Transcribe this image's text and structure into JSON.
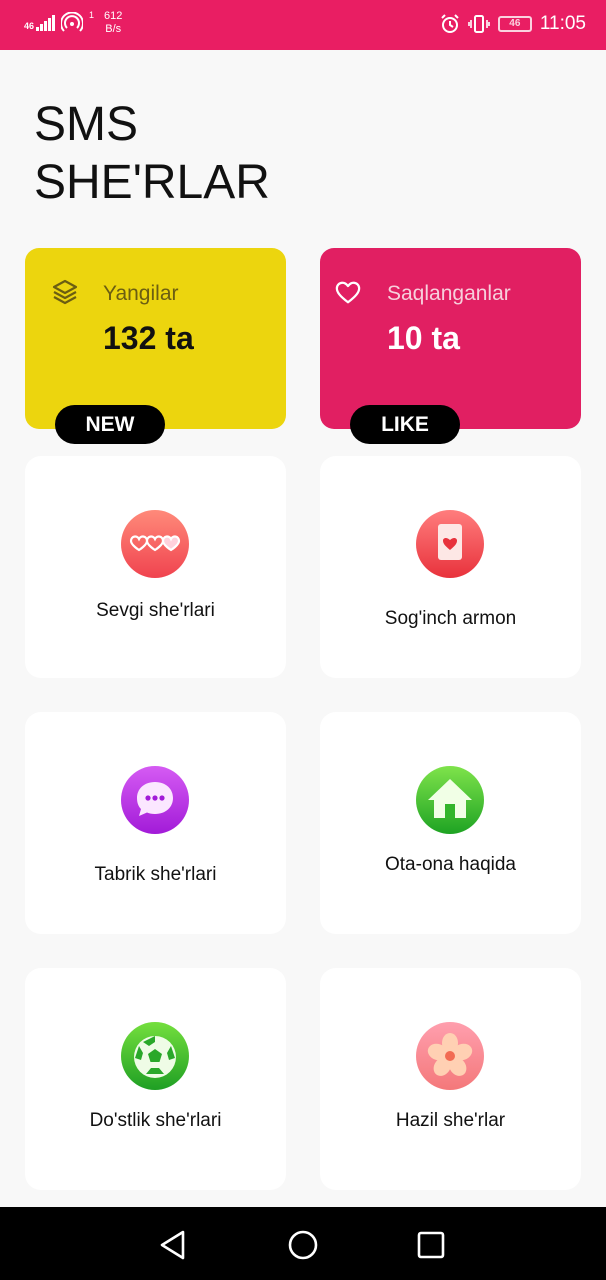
{
  "status_bar": {
    "network_type": "46",
    "sim_index": "1",
    "speed_value": "612",
    "speed_unit": "B/s",
    "battery_level": "46",
    "time": "11:05"
  },
  "header": {
    "title_line1": "SMS",
    "title_line2": "SHE'RLAR"
  },
  "cards": {
    "new": {
      "label": "Yangilar",
      "count": "132 ta",
      "badge": "NEW",
      "icon": "layers-icon",
      "color": "#ecd50e"
    },
    "like": {
      "label": "Saqlanganlar",
      "count": "10 ta",
      "badge": "LIKE",
      "icon": "heart-outline-icon",
      "color": "#e11f62"
    }
  },
  "categories": [
    {
      "label": "Sevgi she'rlari",
      "icon": "hearts-glasses-icon"
    },
    {
      "label": "Sog'inch armon",
      "icon": "heart-card-icon"
    },
    {
      "label": "Tabrik she'rlari",
      "icon": "chat-bubble-icon"
    },
    {
      "label": "Ota-ona haqida",
      "icon": "home-icon"
    },
    {
      "label": "Do'stlik she'rlari",
      "icon": "soccer-ball-icon"
    },
    {
      "label": "Hazil she'rlar",
      "icon": "flower-icon"
    }
  ],
  "colors": {
    "accent": "#e91e63",
    "background": "#f8f8f8"
  },
  "nav": {
    "back": "back-icon",
    "home": "home-circle-icon",
    "recents": "recents-icon"
  }
}
